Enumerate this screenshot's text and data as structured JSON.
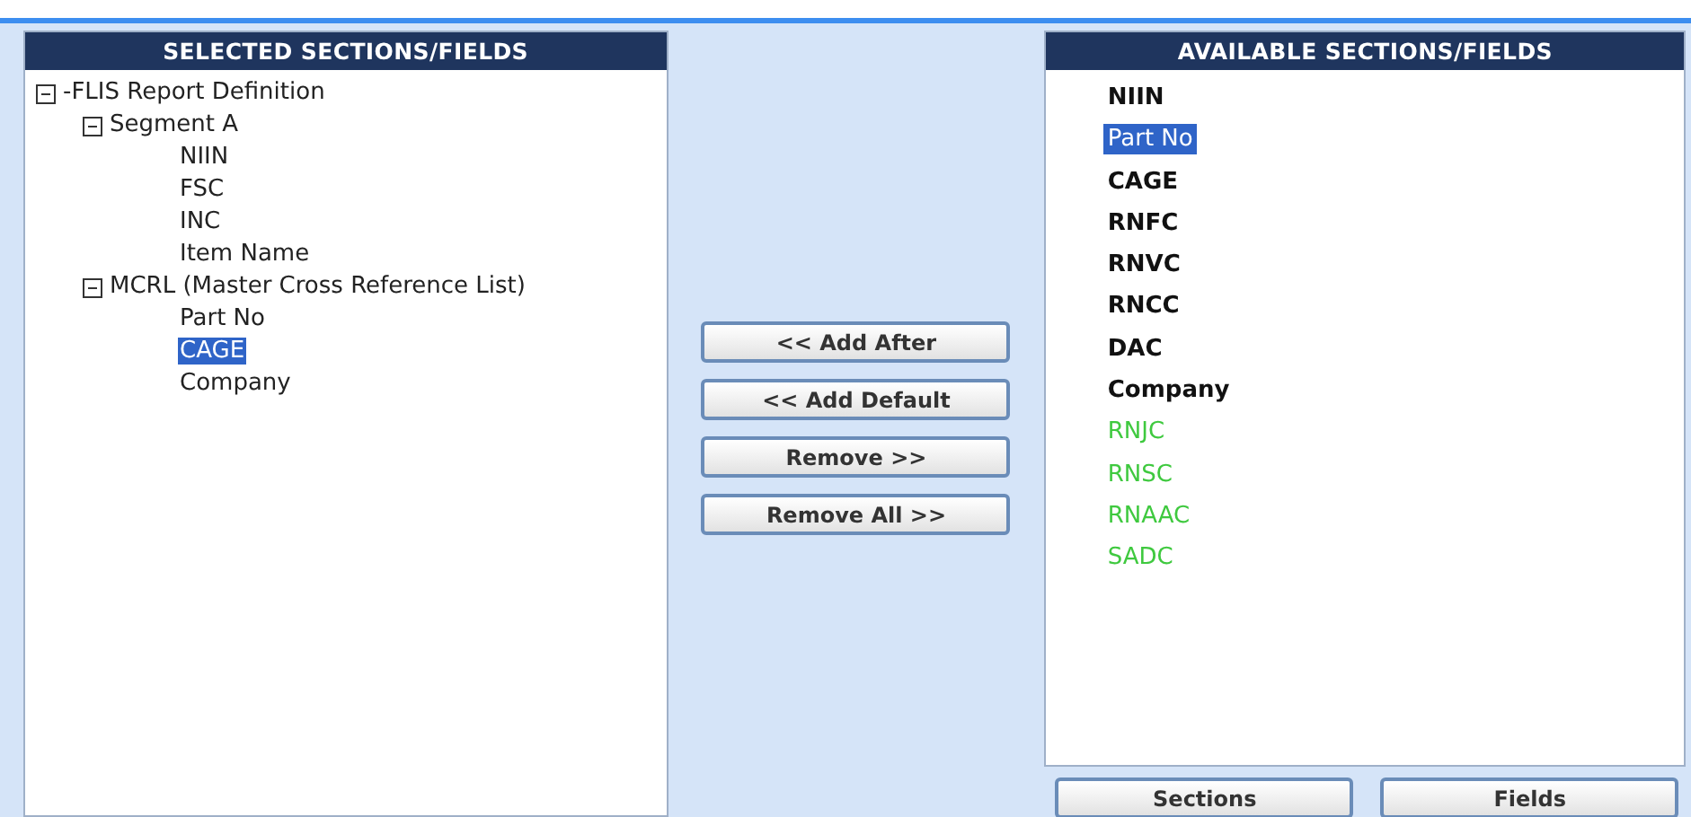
{
  "selected_panel": {
    "title": "SELECTED SECTIONS/FIELDS",
    "tree": [
      {
        "label": "-FLIS Report Definition",
        "expanded": true,
        "children": [
          {
            "label": "Segment A",
            "expanded": true,
            "children": [
              {
                "label": "NIIN",
                "selected": false
              },
              {
                "label": "FSC",
                "selected": false
              },
              {
                "label": "INC",
                "selected": false
              },
              {
                "label": "Item Name",
                "selected": false
              }
            ]
          },
          {
            "label": "MCRL (Master Cross Reference List)",
            "expanded": true,
            "children": [
              {
                "label": "Part No",
                "selected": false
              },
              {
                "label": "CAGE",
                "selected": true
              },
              {
                "label": "Company",
                "selected": false
              }
            ]
          }
        ]
      }
    ]
  },
  "move_buttons": [
    "<< Add After",
    "<< Add Default",
    "Remove >>",
    "Remove All >>"
  ],
  "available_panel": {
    "title": "AVAILABLE SECTIONS/FIELDS",
    "items": [
      {
        "label": "NIIN",
        "kind": "bold",
        "color": "#111111",
        "selected": false
      },
      {
        "label": "Part No",
        "kind": "plain",
        "selected": true
      },
      {
        "label": "CAGE",
        "kind": "bold",
        "color": "#111111",
        "selected": false
      },
      {
        "label": "RNFC",
        "kind": "bold",
        "color": "#111111",
        "selected": false
      },
      {
        "label": "RNVC",
        "kind": "bold",
        "color": "#111111",
        "selected": false
      },
      {
        "label": "RNCC",
        "kind": "bold",
        "color": "#111111",
        "selected": false
      },
      {
        "label": "DAC",
        "kind": "bold",
        "color": "#111111",
        "selected": false
      },
      {
        "label": "Company",
        "kind": "bold",
        "color": "#111111",
        "selected": false
      },
      {
        "label": "RNJC",
        "kind": "plain",
        "color": "#3fc93f",
        "selected": false
      },
      {
        "label": "RNSC",
        "kind": "plain",
        "color": "#3fc93f",
        "selected": false
      },
      {
        "label": "RNAAC",
        "kind": "plain",
        "color": "#3fc93f",
        "selected": false
      },
      {
        "label": "SADC",
        "kind": "plain",
        "color": "#3fc93f",
        "selected": false
      }
    ]
  },
  "bottom_buttons": [
    "Sections",
    "Fields"
  ]
}
